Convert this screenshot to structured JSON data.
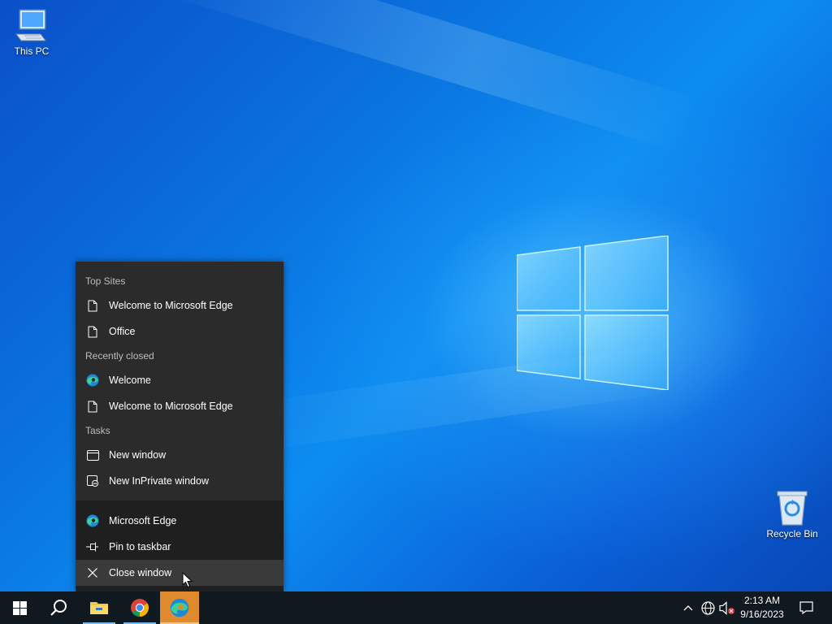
{
  "desktop": {
    "icons": [
      {
        "label": "This PC",
        "icon": "computer-icon"
      },
      {
        "label": "Recycle Bin",
        "icon": "recycle-bin-icon"
      }
    ]
  },
  "jumplist": {
    "sections": {
      "top_sites": "Top Sites",
      "recently_closed": "Recently closed",
      "tasks": "Tasks"
    },
    "top_sites": [
      {
        "label": "Welcome to Microsoft Edge",
        "icon": "page-icon"
      },
      {
        "label": "Office",
        "icon": "page-icon"
      }
    ],
    "recently_closed": [
      {
        "label": "Welcome",
        "icon": "edge-icon"
      },
      {
        "label": "Welcome to Microsoft Edge",
        "icon": "page-icon"
      }
    ],
    "tasks": [
      {
        "label": "New window",
        "icon": "window-icon"
      },
      {
        "label": "New InPrivate window",
        "icon": "inprivate-icon"
      }
    ],
    "app": [
      {
        "label": "Microsoft Edge",
        "icon": "edge-icon"
      },
      {
        "label": "Pin to taskbar",
        "icon": "pin-icon"
      },
      {
        "label": "Close window",
        "icon": "close-icon"
      }
    ]
  },
  "taskbar": {
    "apps": [
      {
        "name": "Start",
        "icon": "windows-start-icon"
      },
      {
        "name": "Search",
        "icon": "search-icon"
      },
      {
        "name": "File Explorer",
        "icon": "folder-icon"
      },
      {
        "name": "Google Chrome",
        "icon": "chrome-icon"
      },
      {
        "name": "Microsoft Edge",
        "icon": "edge-icon"
      }
    ],
    "clock": {
      "time": "2:13 AM",
      "date": "9/16/2023"
    },
    "tray": [
      "chevron-up-icon",
      "network-icon",
      "volume-muted-icon",
      "notification-icon"
    ]
  },
  "colors": {
    "jumplist_bg": "#2b2b2b",
    "jumplist_app_bg": "#1f1f1f",
    "taskbar_bg": "#101820",
    "active_app_highlight": "#e08a2e"
  }
}
